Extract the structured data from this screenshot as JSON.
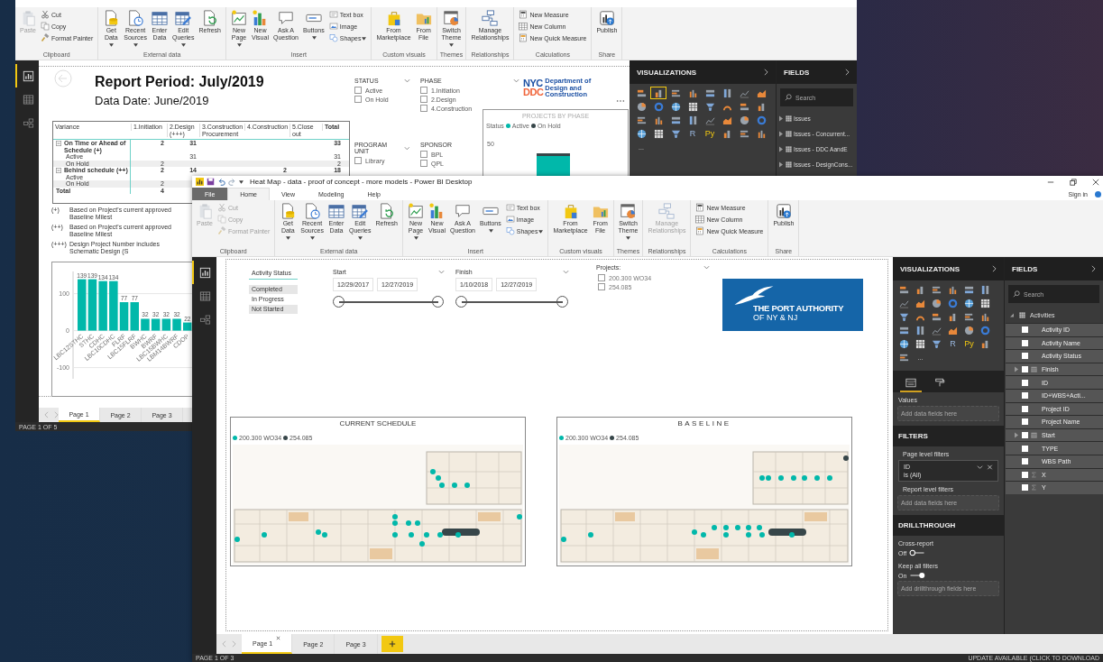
{
  "back_window": {
    "ribbon": {
      "groups": [
        {
          "label": "Clipboard",
          "items": [
            {
              "label": "Paste",
              "kind": "large",
              "dropdown": false,
              "disabled": true
            },
            {
              "label": "Cut",
              "kind": "small",
              "dropdown": false,
              "disabled": false
            },
            {
              "label": "Copy",
              "kind": "small",
              "dropdown": false,
              "disabled": false
            },
            {
              "label": "Format Painter",
              "kind": "small",
              "dropdown": false,
              "disabled": false
            }
          ]
        },
        {
          "label": "External data",
          "items": [
            {
              "label": "Get Data",
              "kind": "large",
              "dropdown": true,
              "disabled": false
            },
            {
              "label": "Recent Sources",
              "kind": "large",
              "dropdown": true,
              "disabled": false
            },
            {
              "label": "Enter Data",
              "kind": "large",
              "dropdown": false,
              "disabled": false
            },
            {
              "label": "Edit Queries",
              "kind": "large",
              "dropdown": true,
              "disabled": false
            },
            {
              "label": "Refresh",
              "kind": "large",
              "dropdown": false,
              "disabled": false
            }
          ]
        },
        {
          "label": "Insert",
          "items": [
            {
              "label": "New Page",
              "kind": "large",
              "dropdown": true,
              "disabled": false
            },
            {
              "label": "New Visual",
              "kind": "large",
              "dropdown": false,
              "disabled": false
            },
            {
              "label": "Ask A Question",
              "kind": "large",
              "dropdown": false,
              "disabled": false
            },
            {
              "label": "Buttons",
              "kind": "large",
              "dropdown": true,
              "disabled": false
            },
            {
              "label": "Text box",
              "kind": "small",
              "dropdown": false,
              "disabled": false
            },
            {
              "label": "Image",
              "kind": "small",
              "dropdown": false,
              "disabled": false
            },
            {
              "label": "Shapes",
              "kind": "small",
              "dropdown": true,
              "disabled": false
            }
          ]
        },
        {
          "label": "Custom visuals",
          "items": [
            {
              "label": "From Marketplace",
              "kind": "large",
              "dropdown": false,
              "disabled": false
            },
            {
              "label": "From File",
              "kind": "large",
              "dropdown": false,
              "disabled": false
            }
          ]
        },
        {
          "label": "Themes",
          "items": [
            {
              "label": "Switch Theme",
              "kind": "large",
              "dropdown": true,
              "disabled": false
            }
          ]
        },
        {
          "label": "Relationships",
          "items": [
            {
              "label": "Manage Relationships",
              "kind": "large",
              "dropdown": false,
              "disabled": false
            }
          ]
        },
        {
          "label": "Calculations",
          "items": [
            {
              "label": "New Measure",
              "kind": "small",
              "dropdown": false,
              "disabled": false
            },
            {
              "label": "New Column",
              "kind": "small",
              "dropdown": false,
              "disabled": false
            },
            {
              "label": "New Quick Measure",
              "kind": "small",
              "dropdown": false,
              "disabled": false
            }
          ]
        },
        {
          "label": "Share",
          "items": [
            {
              "label": "Publish",
              "kind": "large",
              "dropdown": false,
              "disabled": false
            }
          ]
        }
      ]
    },
    "nav_views": [
      {
        "selected": true
      },
      {
        "selected": false
      },
      {
        "selected": false
      }
    ],
    "report": {
      "title": "Report Period: July/2019",
      "subtitle": "Data Date: June/2019",
      "matrix": {
        "columns": [
          "Variance",
          "1.Initiation",
          "2.Design (+++)",
          "3.Construction Procurement",
          "4.Construction",
          "5.Close out",
          "Total"
        ],
        "rows": [
          {
            "label": "On Time or Ahead of Schedule (+)",
            "kind": "group",
            "initiation": "2",
            "design": "31",
            "total": "33"
          },
          {
            "label": "Active",
            "kind": "detail",
            "design": "31",
            "total": "31"
          },
          {
            "label": "On Hold",
            "kind": "detail",
            "initiation": "2",
            "total": "2"
          },
          {
            "label": "Behind schedule (++)",
            "kind": "group",
            "initiation": "2",
            "design": "14",
            "construction": "2",
            "total": "18"
          },
          {
            "label": "Active",
            "kind": "detail"
          },
          {
            "label": "On Hold",
            "kind": "detail",
            "initiation": "2"
          },
          {
            "label": "Total",
            "kind": "total",
            "initiation": "4"
          }
        ]
      },
      "footnotes": [
        {
          "mark": "(+)",
          "text": "Based on Project's current approved Baseline Milest"
        },
        {
          "mark": "(++)",
          "text": "Based on Project's current approved Baseline Milest"
        },
        {
          "mark": "(+++)",
          "text": "Design Project Number includes Schematic Design (S"
        }
      ],
      "chart_data": {
        "type": "bar",
        "categories": [
          "LBC12STHC",
          "STHC",
          "CDHC",
          "LBC10CDHC",
          "FLRF",
          "LBC15FLRF",
          "BWHC",
          "BWRF",
          "LBC15BWHC",
          "LBM14BWRF",
          "CDOP"
        ],
        "values": [
          139,
          139,
          134,
          134,
          77,
          77,
          32,
          32,
          32,
          32,
          22
        ],
        "ylim": [
          -130,
          160
        ],
        "yticks": [
          -100,
          0,
          100
        ],
        "grid": true,
        "data_labels": true
      },
      "slicers": [
        {
          "title": "STATUS",
          "dropdown": true,
          "items": [
            {
              "label": "Active",
              "checked": false
            },
            {
              "label": "On Hold",
              "checked": false
            }
          ]
        },
        {
          "title": "PHASE",
          "dropdown": true,
          "items": [
            {
              "label": "1.Initiation",
              "checked": false
            },
            {
              "label": "2.Design",
              "checked": false
            },
            {
              "label": "4.Construction",
              "checked": false
            }
          ]
        },
        {
          "title": "PROGRAM UNIT",
          "dropdown": true,
          "items": [
            {
              "label": "Library",
              "checked": false
            }
          ]
        },
        {
          "title": "SPONSOR",
          "dropdown": false,
          "items": [
            {
              "label": "BPL",
              "checked": false
            },
            {
              "label": "QPL",
              "checked": false
            }
          ]
        }
      ],
      "logo": {
        "mark_top": "NYC",
        "mark_bottom": "DDC",
        "name": "Department of Design and Construction"
      },
      "phase_chart": {
        "title": "PROJECTS BY PHASE",
        "legend_title": "Status",
        "legend": [
          {
            "label": "Active",
            "color": "#01b8aa"
          },
          {
            "label": "On Hold",
            "color": "#374649"
          }
        ],
        "tick": "50"
      }
    },
    "visualizations": {
      "title": "VISUALIZATIONS",
      "icons": [
        {
          "kind": "chart",
          "selected": false
        },
        {
          "kind": "chart",
          "selected": true
        },
        {
          "kind": "chart",
          "selected": false
        },
        {
          "kind": "chart",
          "selected": false
        },
        {
          "kind": "chart",
          "selected": false
        },
        {
          "kind": "chart",
          "selected": false
        },
        {
          "kind": "chart",
          "selected": false
        },
        {
          "kind": "chart",
          "selected": false
        },
        {
          "kind": "chart",
          "selected": false
        },
        {
          "kind": "chart",
          "selected": false
        },
        {
          "kind": "chart",
          "selected": false
        },
        {
          "kind": "chart",
          "selected": false
        },
        {
          "kind": "chart",
          "selected": false
        },
        {
          "kind": "chart",
          "selected": false
        },
        {
          "kind": "chart",
          "selected": false
        },
        {
          "kind": "chart",
          "selected": false
        },
        {
          "kind": "chart",
          "selected": false
        },
        {
          "kind": "chart",
          "selected": false
        },
        {
          "kind": "chart",
          "selected": false
        },
        {
          "kind": "chart",
          "selected": false
        },
        {
          "kind": "chart",
          "selected": false
        },
        {
          "kind": "chart",
          "selected": false
        },
        {
          "kind": "chart",
          "selected": false
        },
        {
          "kind": "chart",
          "selected": false
        },
        {
          "kind": "chart",
          "selected": false
        },
        {
          "kind": "chart",
          "selected": false
        },
        {
          "kind": "chart",
          "selected": false
        },
        {
          "kind": "letter",
          "text": "R",
          "selected": false
        },
        {
          "kind": "letter",
          "text": "Py",
          "selected": false
        },
        {
          "kind": "chart",
          "selected": false
        },
        {
          "kind": "chart",
          "selected": false
        },
        {
          "kind": "chart",
          "selected": false
        },
        {
          "kind": "more",
          "text": "...",
          "selected": false
        }
      ]
    },
    "fields": {
      "title": "FIELDS",
      "search_placeholder": "Search",
      "tables": [
        {
          "name": "Issues",
          "expanded": false
        },
        {
          "name": "Issues - Concurrent...",
          "expanded": false
        },
        {
          "name": "Issues - DDC AandE",
          "expanded": false
        },
        {
          "name": "Issues - DesignCons...",
          "expanded": false
        }
      ]
    },
    "page_tabs": [
      {
        "label": "Page 1",
        "selected": true
      },
      {
        "label": "Page 2",
        "selected": false
      },
      {
        "label": "Page 3",
        "selected": false
      }
    ],
    "status": {
      "page": "PAGE 1 OF 5"
    }
  },
  "front_window": {
    "title": "Heat Map - data - proof of concept - more models - Power BI Desktop",
    "tabs": [
      {
        "label": "File",
        "kind": "file",
        "selected": false
      },
      {
        "label": "Home",
        "kind": "tab",
        "selected": true
      },
      {
        "label": "View",
        "kind": "tab",
        "selected": false
      },
      {
        "label": "Modeling",
        "kind": "tab",
        "selected": false
      },
      {
        "label": "Help",
        "kind": "tab",
        "selected": false
      }
    ],
    "sign_in": "Sign in",
    "ribbon": {
      "groups": [
        {
          "label": "Clipboard",
          "items": [
            {
              "label": "Paste",
              "kind": "large",
              "dropdown": false,
              "disabled": true
            },
            {
              "label": "Cut",
              "kind": "small",
              "dropdown": false,
              "disabled": true
            },
            {
              "label": "Copy",
              "kind": "small",
              "dropdown": false,
              "disabled": true
            },
            {
              "label": "Format Painter",
              "kind": "small",
              "dropdown": false,
              "disabled": true
            }
          ]
        },
        {
          "label": "External data",
          "items": [
            {
              "label": "Get Data",
              "kind": "large",
              "dropdown": true,
              "disabled": false
            },
            {
              "label": "Recent Sources",
              "kind": "large",
              "dropdown": true,
              "disabled": false
            },
            {
              "label": "Enter Data",
              "kind": "large",
              "dropdown": false,
              "disabled": false
            },
            {
              "label": "Edit Queries",
              "kind": "large",
              "dropdown": true,
              "disabled": false
            },
            {
              "label": "Refresh",
              "kind": "large",
              "dropdown": false,
              "disabled": false
            }
          ]
        },
        {
          "label": "Insert",
          "items": [
            {
              "label": "New Page",
              "kind": "large",
              "dropdown": true,
              "disabled": false
            },
            {
              "label": "New Visual",
              "kind": "large",
              "dropdown": false,
              "disabled": false
            },
            {
              "label": "Ask A Question",
              "kind": "large",
              "dropdown": false,
              "disabled": false
            },
            {
              "label": "Buttons",
              "kind": "large",
              "dropdown": true,
              "disabled": false
            },
            {
              "label": "Text box",
              "kind": "small",
              "dropdown": false,
              "disabled": false
            },
            {
              "label": "Image",
              "kind": "small",
              "dropdown": false,
              "disabled": false
            },
            {
              "label": "Shapes",
              "kind": "small",
              "dropdown": true,
              "disabled": false
            }
          ]
        },
        {
          "label": "Custom visuals",
          "items": [
            {
              "label": "From Marketplace",
              "kind": "large",
              "dropdown": false,
              "disabled": false
            },
            {
              "label": "From File",
              "kind": "large",
              "dropdown": false,
              "disabled": false
            }
          ]
        },
        {
          "label": "Themes",
          "items": [
            {
              "label": "Switch Theme",
              "kind": "large",
              "dropdown": true,
              "disabled": false
            }
          ]
        },
        {
          "label": "Relationships",
          "items": [
            {
              "label": "Manage Relationships",
              "kind": "large",
              "dropdown": false,
              "disabled": true
            }
          ]
        },
        {
          "label": "Calculations",
          "items": [
            {
              "label": "New Measure",
              "kind": "small",
              "dropdown": false,
              "disabled": false
            },
            {
              "label": "New Column",
              "kind": "small",
              "dropdown": false,
              "disabled": false
            },
            {
              "label": "New Quick Measure",
              "kind": "small",
              "dropdown": false,
              "disabled": false
            }
          ]
        },
        {
          "label": "Share",
          "items": [
            {
              "label": "Publish",
              "kind": "large",
              "dropdown": false,
              "disabled": false
            }
          ]
        }
      ]
    },
    "nav_views": [
      {
        "selected": true
      },
      {
        "selected": false
      },
      {
        "selected": false
      }
    ],
    "report": {
      "status_slicer": {
        "title": "Activity Status",
        "items": [
          {
            "label": "Completed",
            "selected": true
          },
          {
            "label": "In Progress",
            "selected": false
          },
          {
            "label": "Not Started",
            "selected": true
          }
        ]
      },
      "date_slicers": [
        {
          "title": "Start",
          "from": "12/29/2017",
          "to": "12/27/2019",
          "level": 1
        },
        {
          "title": "Finish",
          "from": "1/10/2018",
          "to": "12/27/2019",
          "level": 1
        }
      ],
      "projects": {
        "title": "Projects:",
        "items": [
          {
            "label": "200.300 WO34",
            "checked": false
          },
          {
            "label": "254.085",
            "checked": false
          }
        ]
      },
      "logo": {
        "line1": "THE PORT AUTHORITY",
        "line2": "OF NY & NJ"
      },
      "maps": [
        {
          "title": "CURRENT SCHEDULE",
          "legend": [
            {
              "label": "200.300 WO34",
              "color": "#01b8aa"
            },
            {
              "label": "254.085",
              "color": "#374649"
            }
          ]
        },
        {
          "title": "BASELINE",
          "legend": [
            {
              "label": "200.300 WO34",
              "color": "#01b8aa"
            },
            {
              "label": "254.085",
              "color": "#374649"
            }
          ]
        }
      ]
    },
    "visualizations": {
      "title": "VISUALIZATIONS",
      "icons": [
        {
          "kind": "chart",
          "selected": false
        },
        {
          "kind": "chart",
          "selected": false
        },
        {
          "kind": "chart",
          "selected": false
        },
        {
          "kind": "chart",
          "selected": false
        },
        {
          "kind": "chart",
          "selected": false
        },
        {
          "kind": "chart",
          "selected": false
        },
        {
          "kind": "chart",
          "selected": false
        },
        {
          "kind": "chart",
          "selected": false
        },
        {
          "kind": "chart",
          "selected": false
        },
        {
          "kind": "chart",
          "selected": false
        },
        {
          "kind": "chart",
          "selected": false
        },
        {
          "kind": "chart",
          "selected": false
        },
        {
          "kind": "chart",
          "selected": false
        },
        {
          "kind": "chart",
          "selected": false
        },
        {
          "kind": "chart",
          "selected": false
        },
        {
          "kind": "chart",
          "selected": false
        },
        {
          "kind": "chart",
          "selected": false
        },
        {
          "kind": "chart",
          "selected": false
        },
        {
          "kind": "chart",
          "selected": false
        },
        {
          "kind": "chart",
          "selected": false
        },
        {
          "kind": "chart",
          "selected": false
        },
        {
          "kind": "chart",
          "selected": false
        },
        {
          "kind": "chart",
          "selected": false
        },
        {
          "kind": "chart",
          "selected": false
        },
        {
          "kind": "chart",
          "selected": false
        },
        {
          "kind": "chart",
          "selected": false
        },
        {
          "kind": "chart",
          "selected": false
        },
        {
          "kind": "letter",
          "text": "R",
          "selected": false
        },
        {
          "kind": "letter",
          "text": "Py",
          "selected": false
        },
        {
          "kind": "chart",
          "selected": false
        },
        {
          "kind": "chart",
          "selected": false
        },
        {
          "kind": "more",
          "text": "...",
          "selected": false
        }
      ],
      "well_tabs": [
        {
          "selected": true
        },
        {
          "selected": false
        }
      ],
      "values_title": "Values",
      "values_drop": "Add data fields here",
      "filters_title": "FILTERS",
      "page_filters_title": "Page level filters",
      "filter_card": {
        "field": "ID",
        "condition": "is (All)"
      },
      "report_filters_title": "Report level filters",
      "report_filters_drop": "Add data fields here",
      "drill_title": "DRILLTHROUGH",
      "toggles": [
        {
          "label": "Cross-report",
          "state_text": "Off",
          "on": false
        },
        {
          "label": "Keep all filters",
          "state_text": "On",
          "on": true
        }
      ],
      "drill_drop": "Add drillthrough fields here"
    },
    "fields": {
      "title": "FIELDS",
      "search_placeholder": "Search",
      "tables": [
        {
          "name": "Activities",
          "expanded": true,
          "fields": [
            {
              "name": "Activity ID",
              "kind": "text",
              "checked": false
            },
            {
              "name": "Activity Name",
              "kind": "text",
              "checked": false
            },
            {
              "name": "Activity Status",
              "kind": "text",
              "checked": false
            },
            {
              "name": "Finish",
              "kind": "date",
              "checked": false
            },
            {
              "name": "ID",
              "kind": "text",
              "checked": false
            },
            {
              "name": "ID+WBS+Acti...",
              "kind": "text",
              "checked": false
            },
            {
              "name": "Project ID",
              "kind": "text",
              "checked": false
            },
            {
              "name": "Project Name",
              "kind": "text",
              "checked": false
            },
            {
              "name": "Start",
              "kind": "date",
              "checked": false
            },
            {
              "name": "TYPE",
              "kind": "text",
              "checked": false
            },
            {
              "name": "WBS Path",
              "kind": "text",
              "checked": false
            },
            {
              "name": "X",
              "kind": "number",
              "checked": false
            },
            {
              "name": "Y",
              "kind": "number",
              "checked": false
            }
          ]
        }
      ]
    },
    "page_tabs": [
      {
        "label": "Page 1",
        "selected": true
      },
      {
        "label": "Page 2",
        "selected": false
      },
      {
        "label": "Page 3",
        "selected": false
      }
    ],
    "status": {
      "page": "PAGE 1 OF 3",
      "notice": "UPDATE AVAILABLE (CLICK TO DOWNLOAD"
    }
  }
}
